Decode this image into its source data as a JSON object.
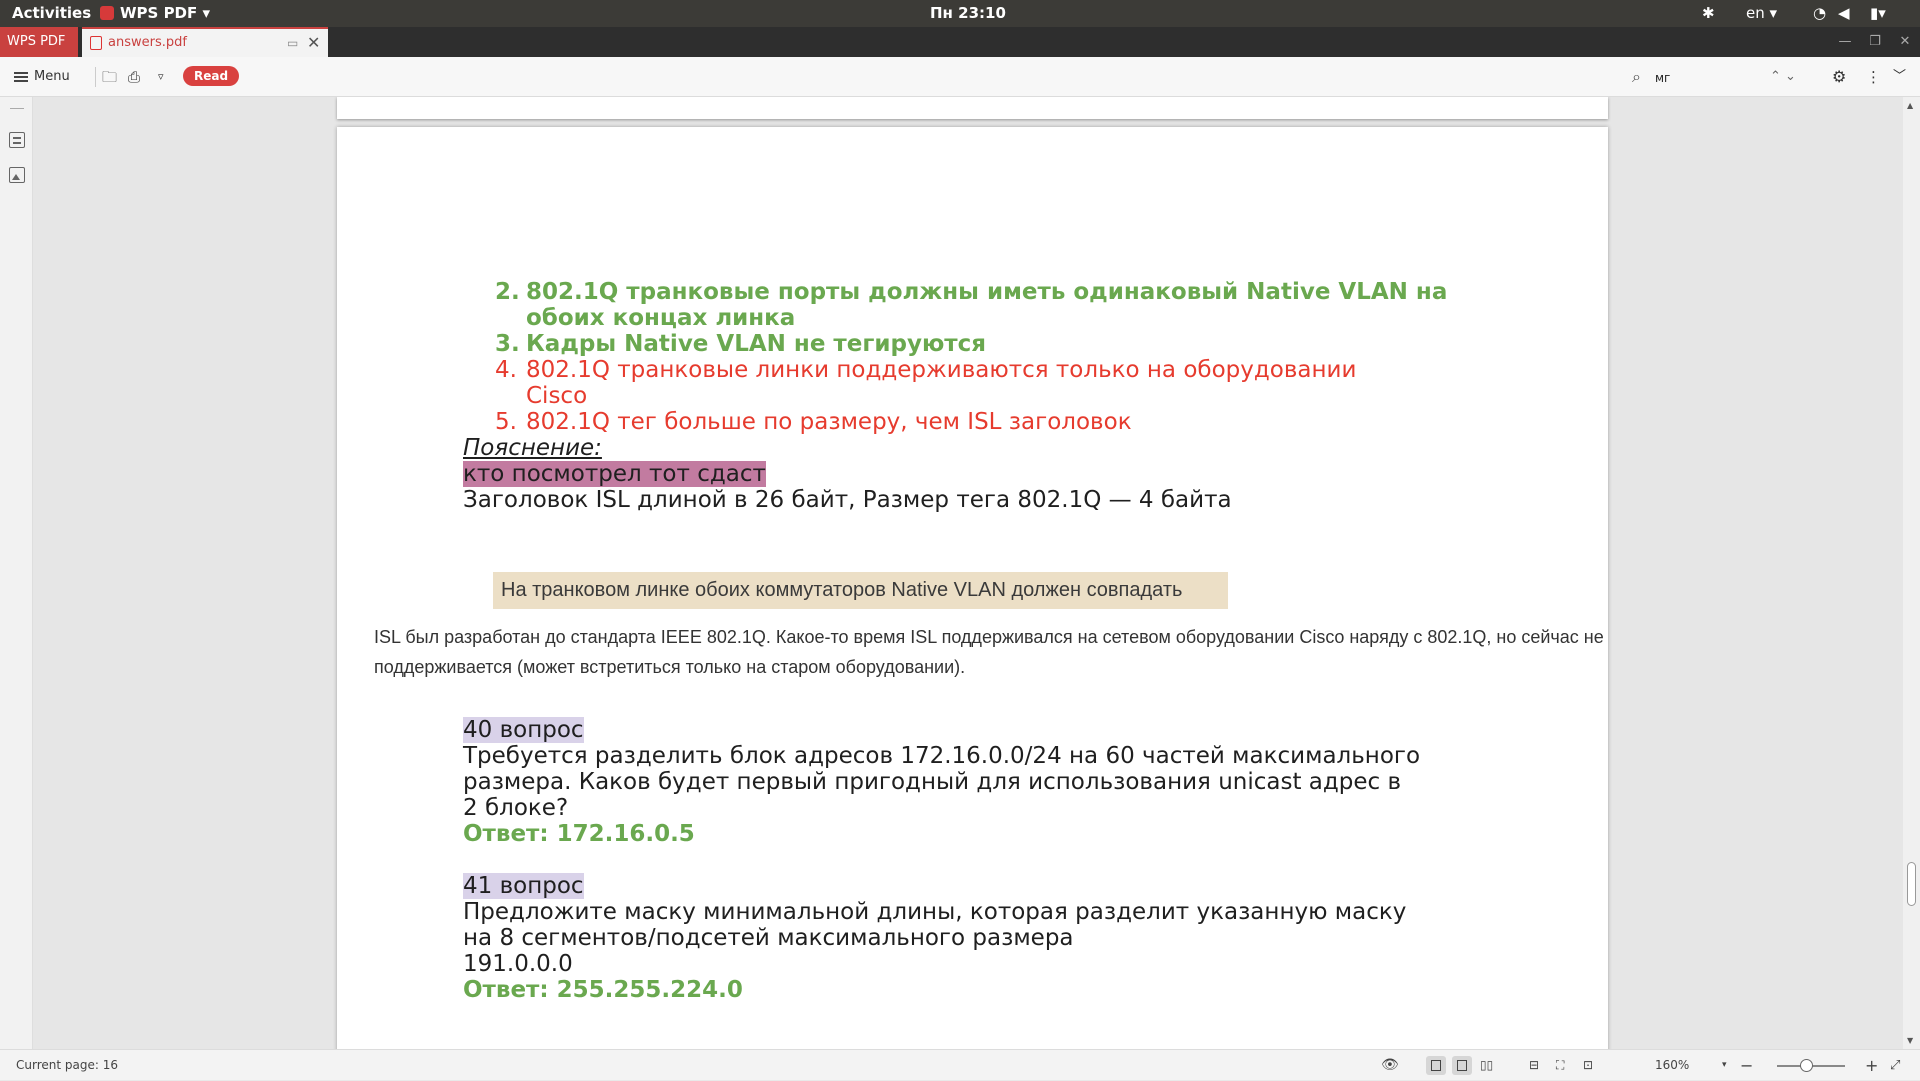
{
  "system_bar": {
    "activities": "Activities",
    "app_menu": "WPS PDF ▾",
    "clock": "Пн 23:10",
    "language": "en ▾"
  },
  "tabs": {
    "home": "WPS PDF",
    "document": "answers.pdf"
  },
  "toolbar": {
    "menu_label": "Menu",
    "read_label": "Read",
    "search_value": "мг"
  },
  "document": {
    "items": [
      {
        "num": "2.",
        "text": "802.1Q транковые порты должны иметь одинаковый Native VLAN на",
        "cont": "обоих концах линка"
      },
      {
        "num": "3.",
        "text": "Кадры Native VLAN не тегируются"
      },
      {
        "num": "4.",
        "text": " 802.1Q транковые линки поддерживаются только на оборудовании",
        "cont": "Cisco"
      },
      {
        "num": "5.",
        "text": " 802.1Q тег больше по размеру, чем ISL заголовок"
      }
    ],
    "explanation_label": "Пояснение:",
    "highlighted_note": "кто посмотрел тот сдаст",
    "isl_note": "Заголовок ISL длиной в 26 байт, Размер тега  802.1Q — 4 байта",
    "scan_box": "На транковом линке обоих коммутаторов Native VLAN должен совпадать",
    "scan_para_1": "ISL был разработан до стандарта IEEE 802.1Q. Какое-то время ISL поддерживался на сетевом оборудовании Cisco наряду с 802.1Q, но сейчас не",
    "scan_para_2": "поддерживается (может встретиться только на старом оборудовании).",
    "q40_label": "40 вопрос",
    "q40_line1": "Требуется разделить блок адресов 172.16.0.0/24 на 60 частей максимального",
    "q40_line2": "размера. Каков будет первый пригодный для использования unicast адрес в",
    "q40_line3": "2 блоке?",
    "q40_answer": "Ответ: 172.16.0.5",
    "q41_label": "41 вопрос",
    "q41_line1": "Предложите маску минимальной длины, которая разделит указанную маску",
    "q41_line2": "на 8 сегментов/подсетей максимального размера",
    "q41_line3": "191.0.0.0",
    "q41_answer_partial": "Ответ: 255.255.224.0"
  },
  "statusbar": {
    "current_page": "Current page: 16",
    "zoom": "160%"
  },
  "colors": {
    "correct_green": "#6aa84f",
    "wrong_red": "#e63b2e",
    "accent_red": "#d9413f",
    "highlight_purple": "#c27ba0",
    "highlight_lavender": "#d9d2e9"
  }
}
